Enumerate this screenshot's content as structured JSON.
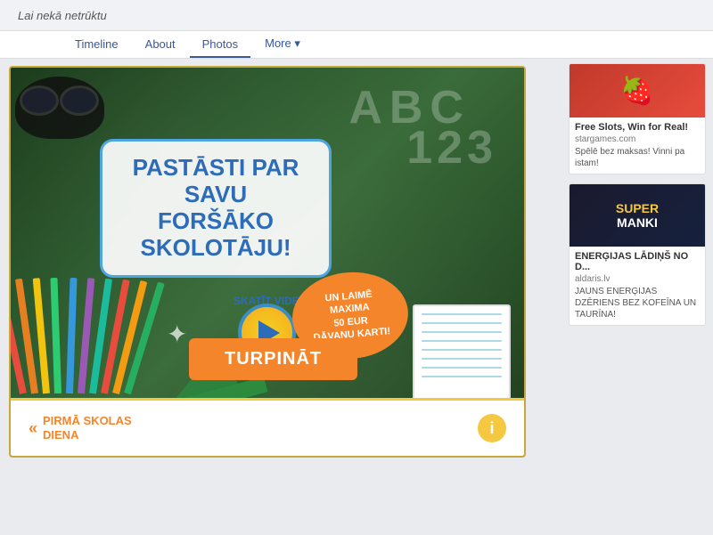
{
  "header": {
    "cover_text": "Lai nekā netrūktu",
    "tabs": [
      {
        "label": "Timeline",
        "active": false
      },
      {
        "label": "About",
        "active": false
      },
      {
        "label": "Photos",
        "active": true
      },
      {
        "label": "More ▾",
        "active": false
      }
    ]
  },
  "promo": {
    "chalk_abc": "ABC",
    "chalk_123": "123",
    "main_text_line1": "PASTĀSTI PAR SAVU",
    "main_text_line2": "FORŠĀKO SKOLOTĀJU!",
    "skaties_label": "SKATĪT VIDEO",
    "orange_bubble_text": "UN LAIMĒ MAXIMA\n50 EUR\nDĀVANU KARTI!",
    "turpinat_label": "TURPINĀT",
    "star_icon": "✦",
    "footer_arrows": "«",
    "footer_back_line1": "PIRMĀ SKOLAS",
    "footer_back_line2": "DIENA",
    "footer_info": "i"
  },
  "sidebar": {
    "ads": [
      {
        "image_icon": "🍓",
        "title": "Free Slots, Win for Real!",
        "source": "stargames.com",
        "desc": "Spēlē bez maksas! Vinni pa istam!"
      },
      {
        "image_text": "SUPER\nMANKI",
        "title": "ENERĢIJAS LĀDIŅŠ NO D...",
        "source": "aldaris.lv",
        "desc": "JAUNS ENERĢIJAS DZĒRIENS BEZ KOFEĪNA UN TAURĪNA!"
      }
    ]
  }
}
